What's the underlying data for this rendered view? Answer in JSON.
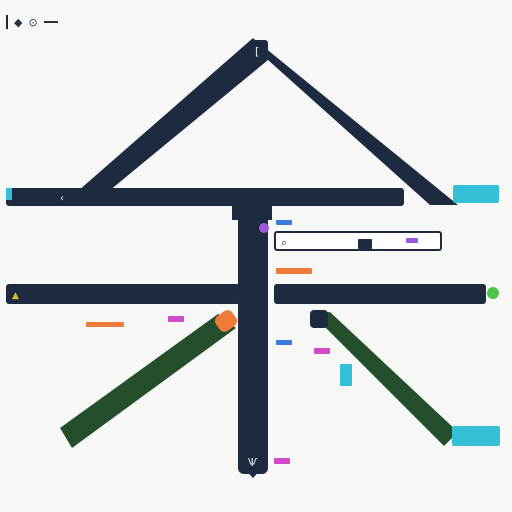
{
  "toolbar": {
    "icons": [
      "diamond-icon",
      "target-icon"
    ],
    "title": ""
  },
  "colors": {
    "background": "#f7f7f6",
    "navy": "#1d2a3f",
    "green": "#254f2c",
    "cyan": "#34c0d6",
    "orange": "#f07a3a",
    "magenta": "#d14ac8",
    "purple": "#9b59e0",
    "blue": "#3b7be0",
    "lime": "#4cc24a",
    "yellow": "#d8c020",
    "gray_text": "#8a8e96"
  },
  "icons": {
    "apex": "square-bracket-icon",
    "left_bar_start": "chevron-icon",
    "left_edge": "triangle-icon",
    "right_edge": "dot-icon",
    "bottom": "fork-icon",
    "search": "magnifier-icon"
  }
}
